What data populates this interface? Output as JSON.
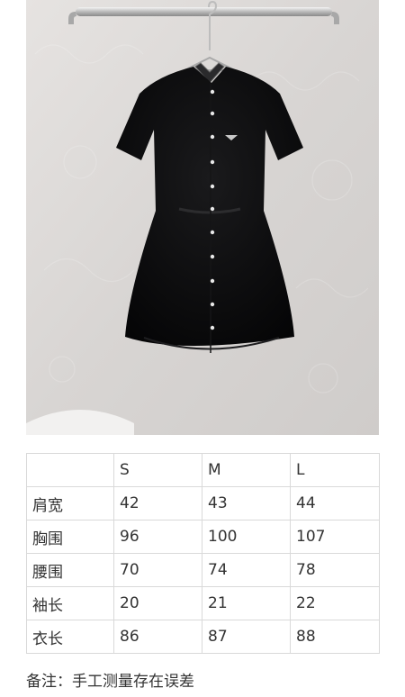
{
  "table": {
    "header": [
      "",
      "S",
      "M",
      "L"
    ],
    "rows": [
      [
        "肩宽",
        "42",
        "43",
        "44"
      ],
      [
        "胸围",
        "96",
        "100",
        "107"
      ],
      [
        "腰围",
        "70",
        "74",
        "78"
      ],
      [
        "袖长",
        "20",
        "21",
        "22"
      ],
      [
        "衣长",
        "86",
        "87",
        "88"
      ]
    ]
  },
  "note": "备注：手工测量存在误差"
}
